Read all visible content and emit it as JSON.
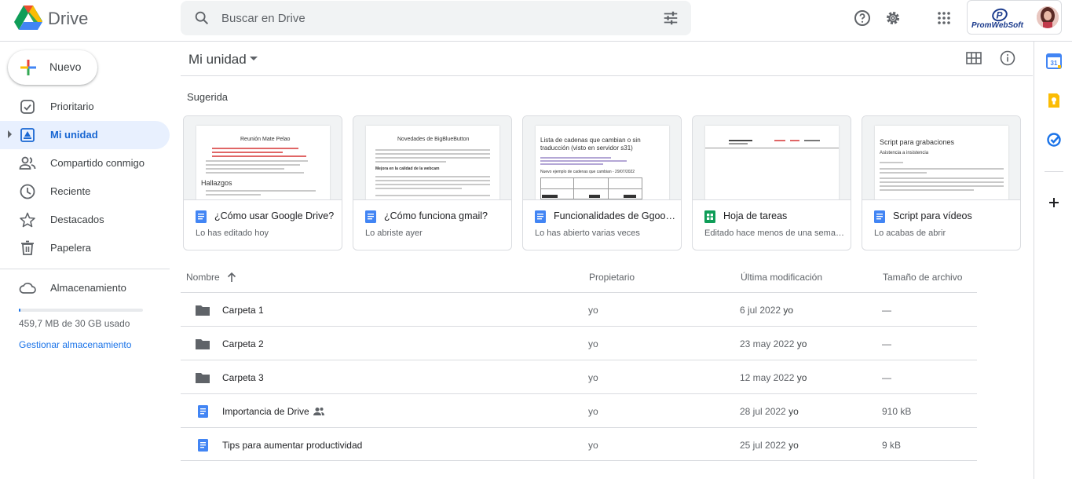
{
  "app": {
    "name": "Drive",
    "logo_icon": "drive-logo-icon",
    "colors": {
      "accent": "#1a73e8",
      "active_bg": "#e8f0fe",
      "active_text": "#1967d2"
    }
  },
  "search": {
    "placeholder": "Buscar en Drive"
  },
  "account": {
    "brand": "PromWebSoft"
  },
  "sidebar": {
    "new_label": "Nuevo",
    "items": [
      {
        "label": "Prioritario",
        "icon": "check-circle-icon",
        "active": false
      },
      {
        "label": "Mi unidad",
        "icon": "my-drive-icon",
        "active": true
      },
      {
        "label": "Compartido conmigo",
        "icon": "people-icon",
        "active": false
      },
      {
        "label": "Reciente",
        "icon": "clock-icon",
        "active": false
      },
      {
        "label": "Destacados",
        "icon": "star-icon",
        "active": false
      },
      {
        "label": "Papelera",
        "icon": "trash-icon",
        "active": false
      }
    ],
    "storage": {
      "label": "Almacenamiento",
      "used_text": "459,7 MB de 30 GB usado",
      "used_fraction": 0.015,
      "manage_label": "Gestionar almacenamiento"
    }
  },
  "main": {
    "title": "Mi unidad",
    "suggested_label": "Sugerida",
    "suggested": [
      {
        "title": "¿Cómo usar Google Drive?",
        "subtitle": "Lo has editado hoy",
        "type": "doc",
        "preview": {
          "heading": "Reunión Mate Pelao",
          "subheading": "Hallazgos"
        }
      },
      {
        "title": "¿Cómo funciona gmail?",
        "subtitle": "Lo abriste ayer",
        "type": "doc",
        "preview": {
          "heading": "Novedades de BigBlueButton",
          "subheading": "Mejora en la calidad de la webcam"
        }
      },
      {
        "title": "Funcionalidades de Ggoogle Drive",
        "subtitle": "Lo has abierto varias veces",
        "type": "doc",
        "preview": {
          "heading": "Lista de cadenas que cambian o sin traducción (visto en servidor s31)",
          "subheading": "Nuevo ejemplo de cadenas que cambian - 29/07/2022"
        }
      },
      {
        "title": "Hoja de tareas",
        "subtitle": "Editado hace menos de una semana",
        "type": "sheet",
        "preview": {
          "heading": "",
          "subheading": ""
        }
      },
      {
        "title": "Script para vídeos",
        "subtitle": "Lo acabas de abrir",
        "type": "doc",
        "preview": {
          "heading": "Script para grabaciones",
          "subheading": "Asistencia a insistencia"
        }
      }
    ],
    "table": {
      "columns": [
        "Nombre",
        "Propietario",
        "Última modificación",
        "Tamaño de archivo"
      ],
      "rows": [
        {
          "name": "Carpeta 1",
          "type": "folder",
          "owner": "yo",
          "date": "6 jul 2022",
          "by": "yo",
          "size": "—",
          "shared": false
        },
        {
          "name": "Carpeta 2",
          "type": "folder",
          "owner": "yo",
          "date": "23 may 2022",
          "by": "yo",
          "size": "—",
          "shared": false
        },
        {
          "name": "Carpeta 3",
          "type": "folder",
          "owner": "yo",
          "date": "12 may 2022",
          "by": "yo",
          "size": "—",
          "shared": false
        },
        {
          "name": "Importancia de Drive",
          "type": "doc",
          "owner": "yo",
          "date": "28 jul 2022",
          "by": "yo",
          "size": "910 kB",
          "shared": true
        },
        {
          "name": "Tips para aumentar productividad",
          "type": "doc",
          "owner": "yo",
          "date": "25 jul 2022",
          "by": "yo",
          "size": "9 kB",
          "shared": false
        }
      ]
    }
  }
}
